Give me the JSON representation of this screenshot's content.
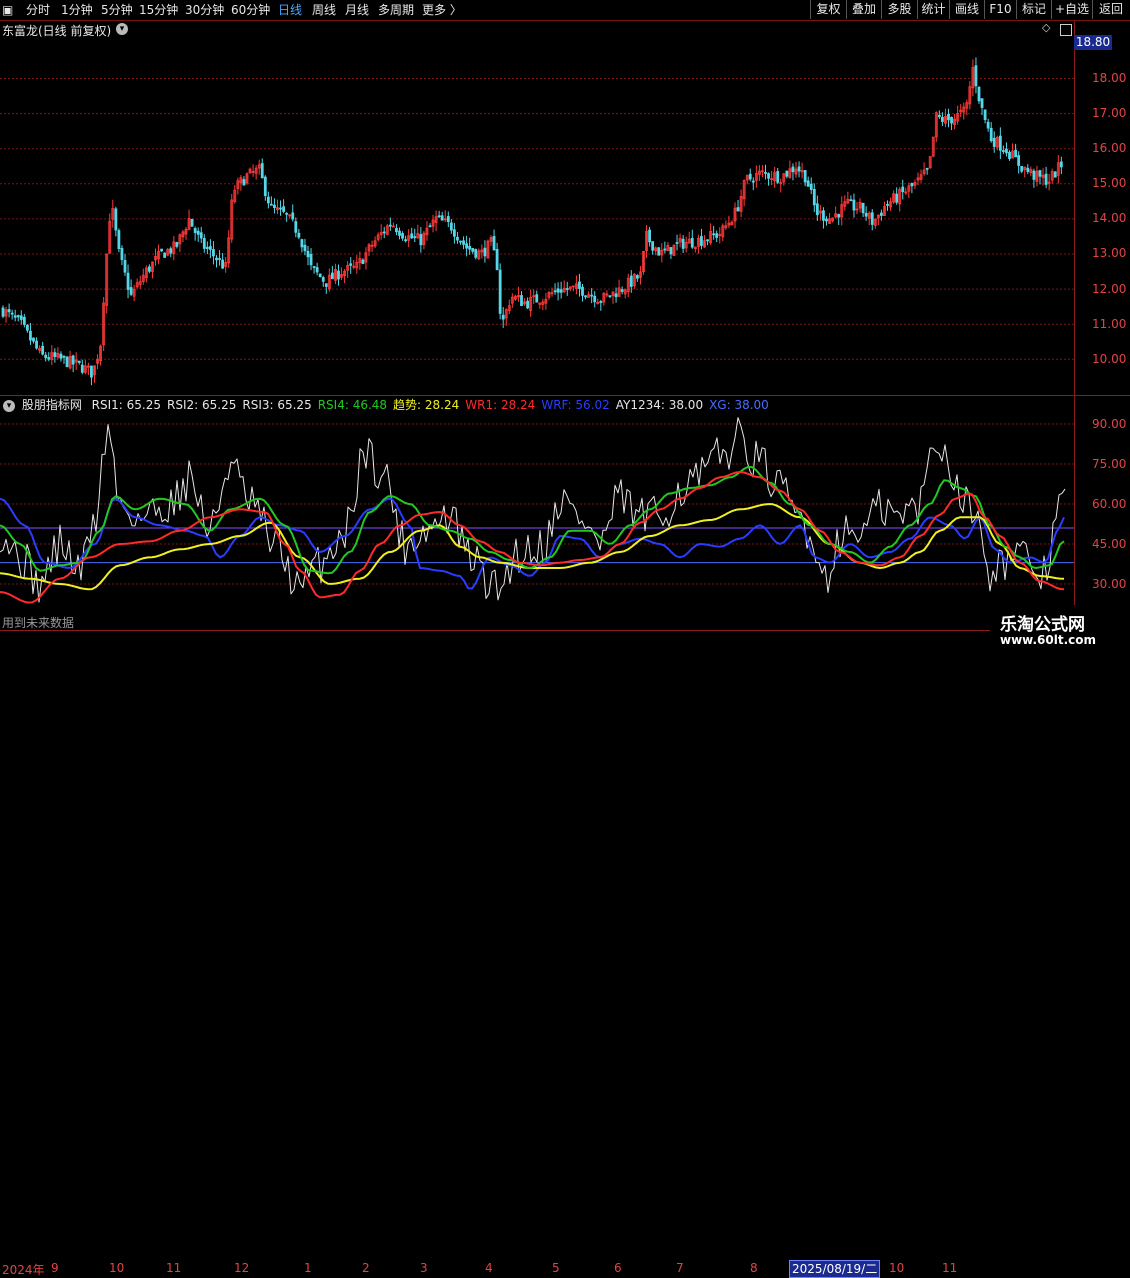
{
  "toolbar": {
    "periods": [
      "分时",
      "1分钟",
      "5分钟",
      "15分钟",
      "30分钟",
      "60分钟",
      "日线",
      "周线",
      "月线",
      "多周期",
      "更多 〉"
    ],
    "active_period": "日线",
    "right_buttons": [
      "复权",
      "叠加",
      "多股",
      "统计",
      "画线",
      "F10",
      "标记",
      "+自选",
      "返回"
    ]
  },
  "title": {
    "stock": "东富龙(日线 前复权)"
  },
  "price_axis": {
    "labels": [
      "18.00",
      "17.00",
      "16.00",
      "15.00",
      "14.00",
      "13.00",
      "12.00",
      "11.00",
      "10.00"
    ],
    "current": "18.80"
  },
  "indicator": {
    "name": "股朋指标网",
    "items": [
      {
        "label": "RSI1: 65.25",
        "color": "#e6e6e6"
      },
      {
        "label": "RSI2: 65.25",
        "color": "#e6e6e6"
      },
      {
        "label": "RSI3: 65.25",
        "color": "#e6e6e6"
      },
      {
        "label": "RSI4: 46.48",
        "color": "#22c722"
      },
      {
        "label": "趋势: 28.24",
        "color": "#f0f020"
      },
      {
        "label": "WR1: 28.24",
        "color": "#ff2a2a"
      },
      {
        "label": "WRF: 56.02",
        "color": "#2a3cff"
      },
      {
        "label": "AY1234: 38.00",
        "color": "#e6e6e6"
      },
      {
        "label": "XG: 38.00",
        "color": "#4a6cff"
      }
    ],
    "axis": [
      "90.00",
      "75.00",
      "60.00",
      "45.00",
      "30.00"
    ],
    "ref_lines": [
      51,
      38
    ]
  },
  "bottom": {
    "future_note": "用到未来数据",
    "year": "2024年",
    "months": [
      "9",
      "10",
      "11",
      "12",
      "1",
      "2",
      "3",
      "4",
      "5",
      "6",
      "7",
      "8",
      "11"
    ],
    "date_box": "2025/08/19/二",
    "month_10": "10"
  },
  "watermark": {
    "line1": "乐淘公式网",
    "line2": "www.60lt.com"
  },
  "colors": {
    "up": "#ff3a3a",
    "down": "#54d8e8",
    "grid": "#8b1a1a",
    "rsi_white": "#e6e6e6",
    "green": "#22c722",
    "yellow": "#f0f020",
    "red": "#ff2a2a",
    "blue": "#2a3cff"
  }
}
